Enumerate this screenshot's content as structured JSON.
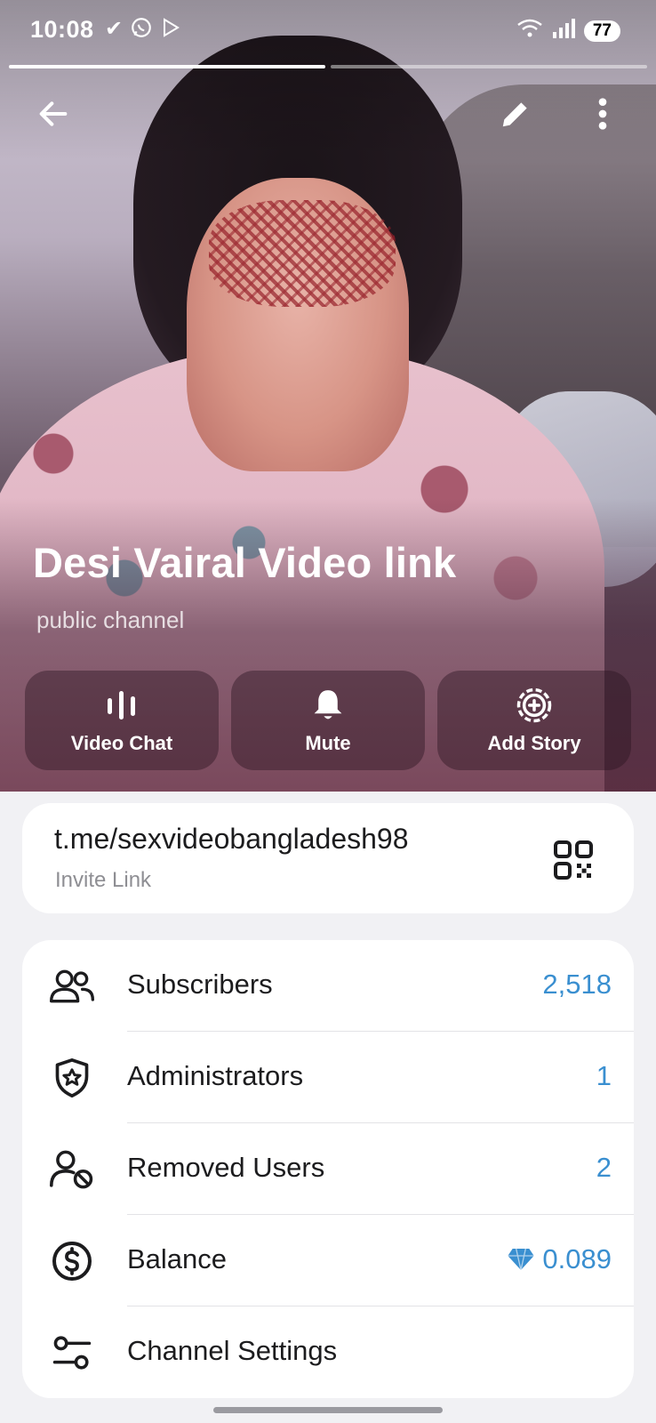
{
  "status_bar": {
    "time": "10:08",
    "left_icons": [
      "check-icon",
      "whatsapp-icon",
      "play-store-icon"
    ],
    "right_icons": [
      "wifi-icon",
      "signal-icon"
    ],
    "battery": "77"
  },
  "toolbar": {
    "back_icon": "arrow-left-icon",
    "edit_icon": "pencil-icon",
    "more_icon": "more-vertical-icon"
  },
  "channel": {
    "title": "Desi Vairal Video link",
    "subtitle": "public channel"
  },
  "actions": [
    {
      "label": "Video Chat",
      "icon": "voice-chat-icon"
    },
    {
      "label": "Mute",
      "icon": "bell-icon"
    },
    {
      "label": "Add Story",
      "icon": "add-story-icon"
    }
  ],
  "invite": {
    "url": "t.me/sexvideobangladesh98",
    "label": "Invite Link",
    "qr_icon": "qr-code-icon"
  },
  "info_rows": [
    {
      "label": "Subscribers",
      "value": "2,518",
      "icon": "users-icon"
    },
    {
      "label": "Administrators",
      "value": "1",
      "icon": "shield-star-icon"
    },
    {
      "label": "Removed Users",
      "value": "2",
      "icon": "user-blocked-icon"
    },
    {
      "label": "Balance",
      "value": "0.089",
      "icon": "dollar-circle-icon",
      "value_icon": "diamond-icon"
    },
    {
      "label": "Channel Settings",
      "value": "",
      "icon": "sliders-icon"
    }
  ],
  "colors": {
    "accent": "#3a8fd0",
    "background": "#f1f1f4",
    "card": "#ffffff"
  }
}
